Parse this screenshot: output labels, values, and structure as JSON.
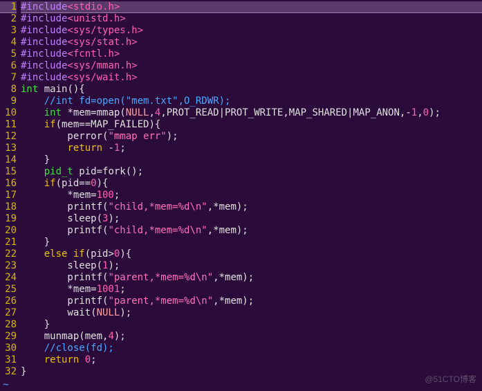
{
  "watermark": "@51CTO博客",
  "lines": [
    {
      "num": 1,
      "highlight": true,
      "tokens": [
        [
          "c-pre",
          "#include"
        ],
        [
          "c-inc",
          "<stdio.h>"
        ]
      ]
    },
    {
      "num": 2,
      "tokens": [
        [
          "c-pre",
          "#include"
        ],
        [
          "c-inc",
          "<unistd.h>"
        ]
      ]
    },
    {
      "num": 3,
      "tokens": [
        [
          "c-pre",
          "#include"
        ],
        [
          "c-inc",
          "<sys/types.h>"
        ]
      ]
    },
    {
      "num": 4,
      "tokens": [
        [
          "c-pre",
          "#include"
        ],
        [
          "c-inc",
          "<sys/stat.h>"
        ]
      ]
    },
    {
      "num": 5,
      "tokens": [
        [
          "c-pre",
          "#include"
        ],
        [
          "c-inc",
          "<fcntl.h>"
        ]
      ]
    },
    {
      "num": 6,
      "tokens": [
        [
          "c-pre",
          "#include"
        ],
        [
          "c-inc",
          "<sys/mman.h>"
        ]
      ]
    },
    {
      "num": 7,
      "tokens": [
        [
          "c-pre",
          "#include"
        ],
        [
          "c-inc",
          "<sys/wait.h>"
        ]
      ]
    },
    {
      "num": 8,
      "tokens": [
        [
          "c-type",
          "int"
        ],
        [
          "",
          " main(){"
        ]
      ]
    },
    {
      "num": 9,
      "tokens": [
        [
          "",
          "    "
        ],
        [
          "c-cmt",
          "//int fd=open(\"mem.txt\",O_RDWR);"
        ]
      ]
    },
    {
      "num": 10,
      "tokens": [
        [
          "",
          "    "
        ],
        [
          "c-type",
          "int"
        ],
        [
          "",
          " *mem=mmap("
        ],
        [
          "c-const",
          "NULL"
        ],
        [
          "",
          ","
        ],
        [
          "c-num",
          "4"
        ],
        [
          "",
          ",PROT_READ|PROT_WRITE,MAP_SHARED|MAP_ANON,-"
        ],
        [
          "c-num",
          "1"
        ],
        [
          "",
          ","
        ],
        [
          "c-num",
          "0"
        ],
        [
          "",
          ");"
        ]
      ]
    },
    {
      "num": 11,
      "tokens": [
        [
          "",
          "    "
        ],
        [
          "c-kw",
          "if"
        ],
        [
          "",
          "(mem==MAP_FAILED){"
        ]
      ]
    },
    {
      "num": 12,
      "tokens": [
        [
          "",
          "        perror("
        ],
        [
          "c-str",
          "\"mmap err\""
        ],
        [
          "",
          ");"
        ]
      ]
    },
    {
      "num": 13,
      "tokens": [
        [
          "",
          "        "
        ],
        [
          "c-kw",
          "return"
        ],
        [
          "",
          " -"
        ],
        [
          "c-num",
          "1"
        ],
        [
          "",
          ";"
        ]
      ]
    },
    {
      "num": 14,
      "tokens": [
        [
          "",
          "    }"
        ]
      ]
    },
    {
      "num": 15,
      "tokens": [
        [
          "",
          "    "
        ],
        [
          "c-type",
          "pid_t"
        ],
        [
          "",
          " pid=fork();"
        ]
      ]
    },
    {
      "num": 16,
      "tokens": [
        [
          "",
          "    "
        ],
        [
          "c-kw",
          "if"
        ],
        [
          "",
          "(pid=="
        ],
        [
          "c-num",
          "0"
        ],
        [
          "",
          "){"
        ]
      ]
    },
    {
      "num": 17,
      "tokens": [
        [
          "",
          "        *mem="
        ],
        [
          "c-num",
          "100"
        ],
        [
          "",
          ";"
        ]
      ]
    },
    {
      "num": 18,
      "tokens": [
        [
          "",
          "        printf("
        ],
        [
          "c-str",
          "\"child,*mem=%d\\n\""
        ],
        [
          "",
          ",*mem);"
        ]
      ]
    },
    {
      "num": 19,
      "tokens": [
        [
          "",
          "        sleep("
        ],
        [
          "c-num",
          "3"
        ],
        [
          "",
          ");"
        ]
      ]
    },
    {
      "num": 20,
      "tokens": [
        [
          "",
          "        printf("
        ],
        [
          "c-str",
          "\"child,*mem=%d\\n\""
        ],
        [
          "",
          ",*mem);"
        ]
      ]
    },
    {
      "num": 21,
      "tokens": [
        [
          "",
          "    }"
        ]
      ]
    },
    {
      "num": 22,
      "tokens": [
        [
          "",
          "    "
        ],
        [
          "c-kw",
          "else if"
        ],
        [
          "",
          "(pid>"
        ],
        [
          "c-num",
          "0"
        ],
        [
          "",
          "){"
        ]
      ]
    },
    {
      "num": 23,
      "tokens": [
        [
          "",
          "        sleep("
        ],
        [
          "c-num",
          "1"
        ],
        [
          "",
          ");"
        ]
      ]
    },
    {
      "num": 24,
      "tokens": [
        [
          "",
          "        printf("
        ],
        [
          "c-str",
          "\"parent,*mem=%d\\n\""
        ],
        [
          "",
          ",*mem);"
        ]
      ]
    },
    {
      "num": 25,
      "tokens": [
        [
          "",
          "        *mem="
        ],
        [
          "c-num",
          "1001"
        ],
        [
          "",
          ";"
        ]
      ]
    },
    {
      "num": 26,
      "tokens": [
        [
          "",
          "        printf("
        ],
        [
          "c-str",
          "\"parent,*mem=%d\\n\""
        ],
        [
          "",
          ",*mem);"
        ]
      ]
    },
    {
      "num": 27,
      "tokens": [
        [
          "",
          "        wait("
        ],
        [
          "c-const",
          "NULL"
        ],
        [
          "",
          ");"
        ]
      ]
    },
    {
      "num": 28,
      "tokens": [
        [
          "",
          "    }"
        ]
      ]
    },
    {
      "num": 29,
      "tokens": [
        [
          "",
          "    munmap(mem,"
        ],
        [
          "c-num",
          "4"
        ],
        [
          "",
          ");"
        ]
      ]
    },
    {
      "num": 30,
      "tokens": [
        [
          "",
          "    "
        ],
        [
          "c-cmt",
          "//close(fd);"
        ]
      ]
    },
    {
      "num": 31,
      "tokens": [
        [
          "",
          "    "
        ],
        [
          "c-kw",
          "return"
        ],
        [
          "",
          " "
        ],
        [
          "c-num",
          "0"
        ],
        [
          "",
          ";"
        ]
      ]
    },
    {
      "num": 32,
      "tokens": [
        [
          "",
          "}"
        ]
      ]
    }
  ],
  "tilde": "~"
}
